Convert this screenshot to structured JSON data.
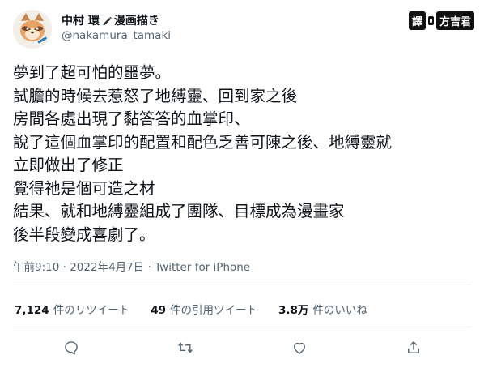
{
  "author": {
    "display_name": "中村 環",
    "display_name_suffix": "漫画描き",
    "handle": "@nakamura_tamaki"
  },
  "translator_credit": {
    "tag": "譯",
    "name": "方吉君"
  },
  "tweet": {
    "lines": [
      "夢到了超可怕的噩夢。",
      "試膽的時候去惹怒了地縛靈、回到家之後",
      "房間各處出現了黏答答的血掌印、",
      "說了這個血掌印的配置和配色乏善可陳之後、地縛靈就",
      "立即做出了修正",
      "覺得祂是個可造之材",
      "結果、就和地縛靈組成了團隊、目標成為漫畫家",
      "後半段變成喜劇了。"
    ],
    "time": "午前9:10",
    "date": "2022年4月7日",
    "separator": "·",
    "source": "Twitter for iPhone"
  },
  "stats": {
    "retweets": {
      "value": "7,124",
      "label": "件のリツイート"
    },
    "quotes": {
      "value": "49",
      "label": "件の引用ツイート"
    },
    "likes": {
      "value": "3.8万",
      "label": "件のいいね"
    }
  },
  "actions": {
    "reply_icon": "reply-icon",
    "retweet_icon": "retweet-icon",
    "like_icon": "heart-icon",
    "share_icon": "share-icon"
  },
  "colors": {
    "text_primary": "#0f1419",
    "text_secondary": "#536471",
    "divider": "#e6ecf0"
  }
}
